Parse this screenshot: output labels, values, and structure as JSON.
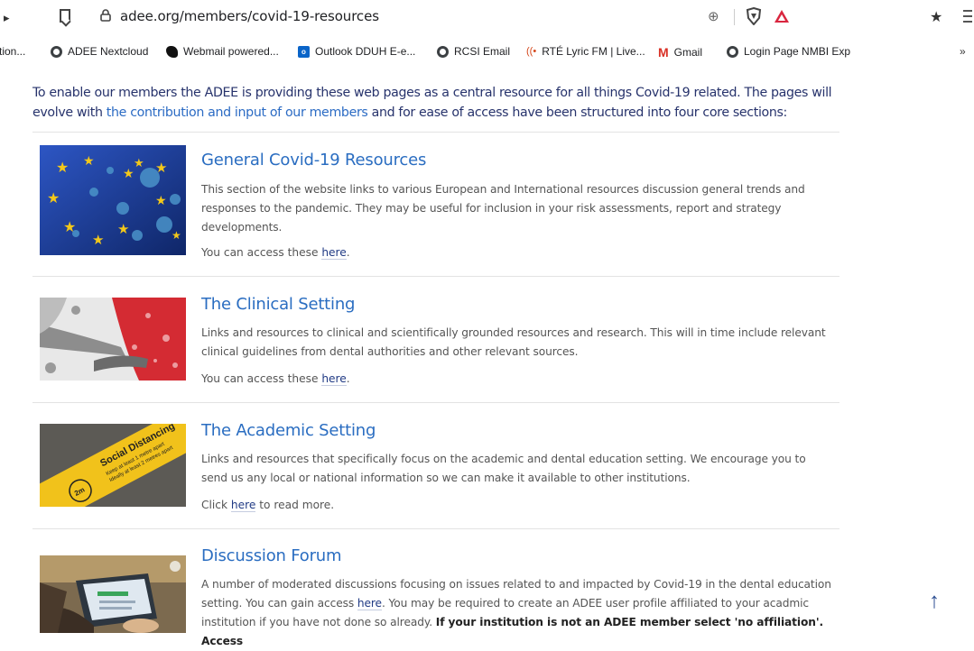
{
  "browser": {
    "url": "adee.org/members/covid-19-resources",
    "bookmarks": [
      {
        "label": "tion...",
        "icon": "none"
      },
      {
        "label": "ADEE Nextcloud",
        "icon": "globe-icon"
      },
      {
        "label": "Webmail powered...",
        "icon": "owl-icon"
      },
      {
        "label": "Outlook DDUH E-e...",
        "icon": "outlook-icon"
      },
      {
        "label": "RCSI Email",
        "icon": "globe-icon"
      },
      {
        "label": "RTÉ Lyric FM | Live...",
        "icon": "radio-icon"
      },
      {
        "label": "Gmail",
        "icon": "gmail-icon"
      },
      {
        "label": "Login Page NMBI Exp",
        "icon": "globe-icon"
      }
    ],
    "more_label": "»"
  },
  "intro": {
    "text_before": "To enable our members the ADEE is providing these web pages as a central resource for all things Covid-19 related. The pages will evolve with ",
    "link_text": "the contribution and input of our members",
    "text_after": " and for ease of access have been structured into four core sections:"
  },
  "sections": [
    {
      "title": "General Covid-19 Resources",
      "body": "This section of the website links to various European and International resources discussion general trends and responses to the pandemic. They may be useful for inclusion in your risk assessments, report and strategy developments.",
      "access_before": "You can access these ",
      "link": "here",
      "access_after": "."
    },
    {
      "title": "The Clinical Setting",
      "body": "Links and resources to clinical and scientifically grounded resources and research. This will in time include relevant clinical guidelines from dental authorities and other relevant sources.",
      "access_before": "You can access these ",
      "link": "here",
      "access_after": "."
    },
    {
      "title": "The Academic Setting",
      "body": "Links and resources that specifically focus on the academic and dental education setting. We encourage you to send us any local or national information so we can make it available to other institutions.",
      "access_before": "Click ",
      "link": "here",
      "access_after": " to read more."
    },
    {
      "title": "Discussion Forum",
      "body_before": "A number of moderated discussions focusing on issues related to and impacted by Covid-19 in the dental education setting. You can gain access ",
      "link": "here",
      "body_middle": ". You may be required to create an ADEE user profile affiliated to your acadmic institution if you have not done so already. ",
      "body_bold": "If your institution is not an ADEE member select 'no affiliation'. Access"
    }
  ],
  "thumbnail_text": {
    "academic_sign_line1": "Social Distancing",
    "academic_sign_line2": "Keep at least 1 metre apart",
    "academic_sign_line3": "Ideally at least 2 metres apart",
    "academic_sign_badge": "2m"
  },
  "scroll_top_icon": "arrow-up-icon",
  "colors": {
    "title_blue": "#2a6dc1",
    "intro_navy": "#27336c",
    "eu_blue": "#1d3f9a",
    "eu_star": "#f3c81a",
    "sign_yellow": "#f1c21b"
  }
}
